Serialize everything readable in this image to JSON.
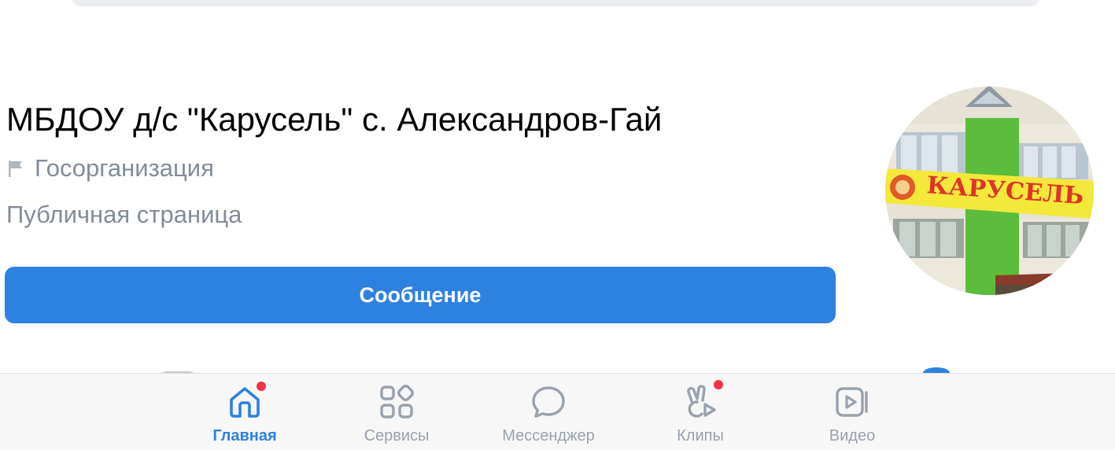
{
  "page": {
    "title": "МБДОУ д/с \"Карусель\" с. Александров-Гай",
    "category": "Госорганизация",
    "subtitle": "Публичная страница",
    "message_button": "Сообщение",
    "avatar_sign_text": "КАРУСЕЛЬ"
  },
  "tabbar": {
    "tabs": [
      {
        "label": "Главная",
        "icon": "home-icon",
        "active": true,
        "badge_dot": true
      },
      {
        "label": "Сервисы",
        "icon": "services-icon",
        "active": false,
        "badge_dot": false
      },
      {
        "label": "Мессенджер",
        "icon": "messenger-icon",
        "active": false,
        "badge_dot": false
      },
      {
        "label": "Клипы",
        "icon": "clips-icon",
        "active": false,
        "badge_dot": true
      },
      {
        "label": "Видео",
        "icon": "video-icon",
        "active": false,
        "badge_dot": false
      }
    ]
  },
  "colors": {
    "accent": "#2d81e0",
    "secondary_text": "#818c99",
    "tab_inactive": "#99a2ad",
    "badge": "#f5314a"
  }
}
